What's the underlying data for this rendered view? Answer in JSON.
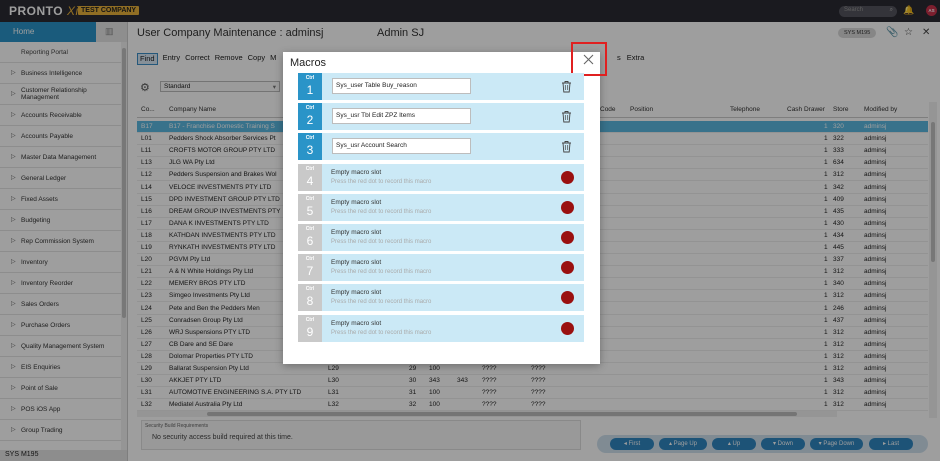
{
  "brand": {
    "logo": "PRONTO",
    "logo_x": "Xi",
    "company_badge": "TEST COMPANY"
  },
  "topbar": {
    "search_placeholder": "Search",
    "avatar": "AS"
  },
  "sidebar": {
    "home": "Home",
    "items": [
      {
        "label": "Reporting Portal",
        "chevron": false
      },
      {
        "label": "Business Intelligence",
        "chevron": true
      },
      {
        "label": "Customer Relationship Management",
        "chevron": true
      },
      {
        "label": "Accounts Receivable",
        "chevron": true
      },
      {
        "label": "Accounts Payable",
        "chevron": true
      },
      {
        "label": "Master Data Management",
        "chevron": true
      },
      {
        "label": "General Ledger",
        "chevron": true
      },
      {
        "label": "Fixed Assets",
        "chevron": true
      },
      {
        "label": "Budgeting",
        "chevron": true
      },
      {
        "label": "Rep Commission System",
        "chevron": true
      },
      {
        "label": "Inventory",
        "chevron": true
      },
      {
        "label": "Inventory Reorder",
        "chevron": true
      },
      {
        "label": "Sales Orders",
        "chevron": true
      },
      {
        "label": "Purchase Orders",
        "chevron": true
      },
      {
        "label": "Quality Management System",
        "chevron": true
      },
      {
        "label": "EIS Enquiries",
        "chevron": true
      },
      {
        "label": "Point of Sale",
        "chevron": true
      },
      {
        "label": "POS iOS App",
        "chevron": true
      },
      {
        "label": "Group Trading",
        "chevron": true
      }
    ],
    "footer": "SYS M195"
  },
  "header": {
    "title": "User Company Maintenance : adminsj",
    "user": "Admin SJ",
    "sys_badge": "SYS M195"
  },
  "toolbar": {
    "items": [
      "Find",
      "Entry",
      "Correct",
      "Remove",
      "Copy",
      "M"
    ],
    "right_items": [
      "s",
      "Extra"
    ]
  },
  "view": {
    "selected": "Standard"
  },
  "grid": {
    "headers": {
      "code": "Co...",
      "company": "Company Name",
      "pcode": "Code",
      "position": "Position",
      "telephone": "Telephone",
      "drawer": "Cash Drawer",
      "store": "Store",
      "modified": "Modified by"
    },
    "rows": [
      {
        "code": "B17",
        "name": "B17 - Franchise Domestic Training S",
        "c3": "",
        "c4": "",
        "c5": "",
        "c6": "",
        "c7": "",
        "c8": "",
        "drawer": "1",
        "store": "320",
        "mod": "adminsj",
        "sel": true
      },
      {
        "code": "L01",
        "name": "Pedders Shock Absorber Services Pt",
        "c3": "",
        "c4": "",
        "c5": "",
        "c6": "",
        "c7": "",
        "c8": "",
        "drawer": "1",
        "store": "322",
        "mod": "adminsj"
      },
      {
        "code": "L11",
        "name": "CROFTS MOTOR GROUP PTY LTD",
        "c3": "",
        "c4": "",
        "c5": "",
        "c6": "",
        "c7": "",
        "c8": "",
        "drawer": "1",
        "store": "333",
        "mod": "adminsj"
      },
      {
        "code": "L13",
        "name": "JLG WA Pty Ltd",
        "c3": "",
        "c4": "",
        "c5": "",
        "c6": "",
        "c7": "",
        "c8": "",
        "drawer": "1",
        "store": "634",
        "mod": "adminsj"
      },
      {
        "code": "L12",
        "name": "Pedders Suspension and Brakes Wol",
        "c3": "",
        "c4": "",
        "c5": "",
        "c6": "",
        "c7": "",
        "c8": "",
        "drawer": "1",
        "store": "312",
        "mod": "adminsj"
      },
      {
        "code": "L14",
        "name": "VELOCE INVESTMENTS PTY LTD",
        "c3": "",
        "c4": "",
        "c5": "",
        "c6": "",
        "c7": "",
        "c8": "",
        "drawer": "1",
        "store": "342",
        "mod": "adminsj"
      },
      {
        "code": "L15",
        "name": "DPD INVESTMENT GROUP PTY LTD",
        "c3": "",
        "c4": "",
        "c5": "",
        "c6": "",
        "c7": "",
        "c8": "",
        "drawer": "1",
        "store": "409",
        "mod": "adminsj"
      },
      {
        "code": "L16",
        "name": "DREAM GROUP INVESTMENTS PTY",
        "c3": "",
        "c4": "",
        "c5": "",
        "c6": "",
        "c7": "",
        "c8": "",
        "drawer": "1",
        "store": "435",
        "mod": "adminsj"
      },
      {
        "code": "L17",
        "name": "DANA K INVESTMENTS PTY LTD",
        "c3": "",
        "c4": "",
        "c5": "",
        "c6": "",
        "c7": "",
        "c8": "",
        "drawer": "1",
        "store": "430",
        "mod": "adminsj"
      },
      {
        "code": "L18",
        "name": "KATHDAN INVESTMENTS PTY LTD",
        "c3": "",
        "c4": "",
        "c5": "",
        "c6": "",
        "c7": "",
        "c8": "",
        "drawer": "1",
        "store": "434",
        "mod": "adminsj"
      },
      {
        "code": "L19",
        "name": "RYNKATH INVESTMENTS PTY LTD",
        "c3": "",
        "c4": "",
        "c5": "",
        "c6": "",
        "c7": "",
        "c8": "",
        "drawer": "1",
        "store": "445",
        "mod": "adminsj"
      },
      {
        "code": "L20",
        "name": "PGVM Pty Ltd",
        "c3": "",
        "c4": "",
        "c5": "",
        "c6": "",
        "c7": "",
        "c8": "",
        "drawer": "1",
        "store": "337",
        "mod": "adminsj"
      },
      {
        "code": "L21",
        "name": "A & N White Holdings Pty Ltd",
        "c3": "",
        "c4": "",
        "c5": "",
        "c6": "",
        "c7": "",
        "c8": "",
        "drawer": "1",
        "store": "312",
        "mod": "adminsj"
      },
      {
        "code": "L22",
        "name": "MEMERY BROS PTY LTD",
        "c3": "",
        "c4": "",
        "c5": "",
        "c6": "",
        "c7": "",
        "c8": "",
        "drawer": "1",
        "store": "340",
        "mod": "adminsj"
      },
      {
        "code": "L23",
        "name": "Simgeo Investments Pty Ltd",
        "c3": "",
        "c4": "",
        "c5": "",
        "c6": "",
        "c7": "",
        "c8": "",
        "drawer": "1",
        "store": "312",
        "mod": "adminsj"
      },
      {
        "code": "L24",
        "name": "Pete and Ben the Pedders Men",
        "c3": "",
        "c4": "",
        "c5": "",
        "c6": "",
        "c7": "",
        "c8": "",
        "drawer": "1",
        "store": "246",
        "mod": "adminsj"
      },
      {
        "code": "L25",
        "name": "Conradsen Group Pty Ltd",
        "c3": "",
        "c4": "",
        "c5": "",
        "c6": "",
        "c7": "",
        "c8": "",
        "drawer": "1",
        "store": "437",
        "mod": "adminsj"
      },
      {
        "code": "L26",
        "name": "WRJ Suspensions PTY LTD",
        "c3": "",
        "c4": "",
        "c5": "",
        "c6": "",
        "c7": "",
        "c8": "",
        "drawer": "1",
        "store": "312",
        "mod": "adminsj"
      },
      {
        "code": "L27",
        "name": "CB Dare and SE Dare",
        "c3": "",
        "c4": "",
        "c5": "",
        "c6": "",
        "c7": "",
        "c8": "",
        "drawer": "1",
        "store": "312",
        "mod": "adminsj"
      },
      {
        "code": "L28",
        "name": "Dolomar Properties PTY LTD",
        "c3": "",
        "c4": "",
        "c5": "",
        "c6": "",
        "c7": "",
        "c8": "",
        "drawer": "1",
        "store": "312",
        "mod": "adminsj"
      },
      {
        "code": "L29",
        "name": "Ballarat Suspension Pty Ltd",
        "c3": "L29",
        "c4": "29",
        "c5": "100",
        "c6": "",
        "c7": "????",
        "c8": "????",
        "drawer": "1",
        "store": "312",
        "mod": "adminsj"
      },
      {
        "code": "L30",
        "name": "AKKJET PTY LTD",
        "c3": "L30",
        "c4": "30",
        "c5": "343",
        "c6": "343",
        "c7": "????",
        "c8": "????",
        "drawer": "1",
        "store": "343",
        "mod": "adminsj"
      },
      {
        "code": "L31",
        "name": "AUTOMOTIVE ENGINEERING S.A. PTY LTD",
        "c3": "L31",
        "c4": "31",
        "c5": "100",
        "c6": "",
        "c7": "????",
        "c8": "????",
        "drawer": "1",
        "store": "312",
        "mod": "adminsj"
      },
      {
        "code": "L32",
        "name": "Mediatel Australia Pty Ltd",
        "c3": "L32",
        "c4": "32",
        "c5": "100",
        "c6": "",
        "c7": "????",
        "c8": "????",
        "drawer": "1",
        "store": "312",
        "mod": "adminsj"
      }
    ]
  },
  "status": {
    "title": "Security Build Requirements",
    "message": "No security access build required at this time."
  },
  "nav": {
    "first": "First",
    "page_up": "Page Up",
    "up": "Up",
    "down": "Down",
    "page_down": "Page Down",
    "last": "Last"
  },
  "macros": {
    "title": "Macros",
    "ctrl_label": "Ctrl",
    "slots": [
      {
        "num": "1",
        "value": "Sys_user Table Buy_reason",
        "empty": false
      },
      {
        "num": "2",
        "value": "Sys_usr Tbl Edit ZPZ Items",
        "empty": false
      },
      {
        "num": "3",
        "value": "Sys_usr Account Search",
        "empty": false
      },
      {
        "num": "4",
        "value": "Empty macro slot",
        "empty": true
      },
      {
        "num": "5",
        "value": "Empty macro slot",
        "empty": true
      },
      {
        "num": "6",
        "value": "Empty macro slot",
        "empty": true
      },
      {
        "num": "7",
        "value": "Empty macro slot",
        "empty": true
      },
      {
        "num": "8",
        "value": "Empty macro slot",
        "empty": true
      },
      {
        "num": "9",
        "value": "Empty macro slot",
        "empty": true
      }
    ],
    "empty_hint": "Press the red dot to record this macro"
  }
}
